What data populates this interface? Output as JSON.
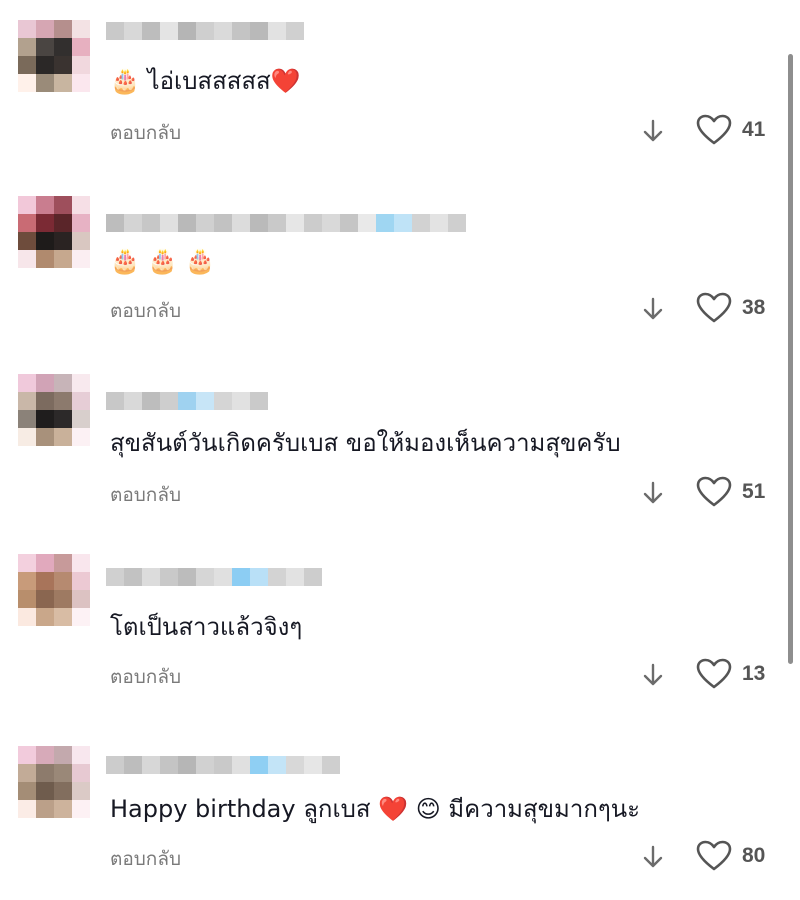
{
  "comments": [
    {
      "text": "🎂 ไอ่เบสสสสส❤️",
      "reply_label": "ตอบกลับ",
      "like_count": "41",
      "avatar_colors": [
        "#e9c7d4",
        "#d6a6b3",
        "#b58f8d",
        "#f3e2e4",
        "#b2a18e",
        "#4a4542",
        "#322f2e",
        "#e7b0c0",
        "#7a6a5a",
        "#2b2827",
        "#3a3330",
        "#f1d8de",
        "#fff1ea",
        "#9a8b79",
        "#c8b5a0",
        "#fbe7ee"
      ],
      "username_colors": [
        "#c9c9c9",
        "#d8d8d8",
        "#bdbdbd",
        "#e4e4e4",
        "#b5b5b5",
        "#cfcfcf",
        "#dadada",
        "#c4c4c4",
        "#b9b9b9",
        "#e2e2e2",
        "#d0d0d0"
      ]
    },
    {
      "text": "🎂 🎂 🎂",
      "reply_label": "ตอบกลับ",
      "like_count": "38",
      "avatar_colors": [
        "#f2c8d9",
        "#c97d8f",
        "#9e4f5c",
        "#f6dfe6",
        "#c96b74",
        "#7b2a34",
        "#5a2529",
        "#e7b2c4",
        "#6e4c3c",
        "#1e1b1a",
        "#2a2322",
        "#d9c7c1",
        "#f7e6ea",
        "#b08a6e",
        "#c6a88e",
        "#fbeef2"
      ],
      "username_colors": [
        "#bdbdbd",
        "#d4d4d4",
        "#c7c7c7",
        "#e0e0e0",
        "#b9b9b9",
        "#d0d0d0",
        "#c2c2c2",
        "#dcdcdc",
        "#bababa",
        "#c9c9c9",
        "#e6e6e6",
        "#cccccc",
        "#d9d9d9",
        "#c5c5c5",
        "#e9e9e9",
        "#9fd6f2",
        "#bfe3f7",
        "#d2d2d2",
        "#e3e3e3",
        "#cfcfcf"
      ]
    },
    {
      "text": "สุขสันต์วันเกิดครับเบส ขอให้มองเห็นความสุขครับ",
      "reply_label": "ตอบกลับ",
      "like_count": "51",
      "avatar_colors": [
        "#f0c9db",
        "#d1a3b6",
        "#c7b4b8",
        "#f8e9ee",
        "#c9b7a8",
        "#7c6b5f",
        "#8c7a6d",
        "#e6cdd6",
        "#8b8279",
        "#1f1d1d",
        "#2c2929",
        "#d8cfcc",
        "#f7ece4",
        "#a8917b",
        "#c9b19a",
        "#fcf1f4"
      ],
      "username_colors": [
        "#c8c8c8",
        "#d9d9d9",
        "#bdbdbd",
        "#cecece",
        "#9fd2f0",
        "#c7e5f7",
        "#d5d5d5",
        "#e1e1e1",
        "#cacaca"
      ]
    },
    {
      "text": "โตเป็นสาวแล้วจิงๆ",
      "reply_label": "ตอบกลับ",
      "like_count": "13",
      "avatar_colors": [
        "#f3d0de",
        "#e1a9bd",
        "#c79a9a",
        "#f9e6ed",
        "#c89b7a",
        "#a8745a",
        "#b68a70",
        "#ecc9d3",
        "#b88e6c",
        "#8a6650",
        "#9e7a62",
        "#dcc2c2",
        "#fbe9e0",
        "#c9a78a",
        "#d8bca4",
        "#fdf2f5"
      ],
      "username_colors": [
        "#d0d0d0",
        "#c2c2c2",
        "#dcdcdc",
        "#c9c9c9",
        "#bcbcbc",
        "#d6d6d6",
        "#e0e0e0",
        "#8ccdf3",
        "#b9e0f7",
        "#d3d3d3",
        "#e2e2e2",
        "#cdcdcd"
      ]
    },
    {
      "text_start": "Happy birthday ลูกเบส ",
      "text_heart": "❤️",
      "text_smile": " 😊 ",
      "text_end": "มีความสุขมากๆนะ",
      "reply_label": "ตอบกลับ",
      "like_count": "80",
      "avatar_colors": [
        "#f2cbdc",
        "#d7aab9",
        "#c3a9ad",
        "#f8e7ee",
        "#c2ab97",
        "#8d7b6c",
        "#9a8878",
        "#e7c9d2",
        "#a48d76",
        "#6f5c4d",
        "#826e5e",
        "#dbcac6",
        "#fbece6",
        "#bba089",
        "#cdb39c",
        "#fdf1f4"
      ],
      "username_colors": [
        "#cccccc",
        "#bdbdbd",
        "#d7d7d7",
        "#c4c4c4",
        "#b6b6b6",
        "#d1d1d1",
        "#c9c9c9",
        "#e0e0e0",
        "#8fcff3",
        "#c3e4f7",
        "#d8d8d8",
        "#e6e6e6",
        "#cfcfcf"
      ]
    }
  ],
  "icons": {
    "dislike": "down-arrow-icon",
    "like": "heart-outline-icon"
  }
}
